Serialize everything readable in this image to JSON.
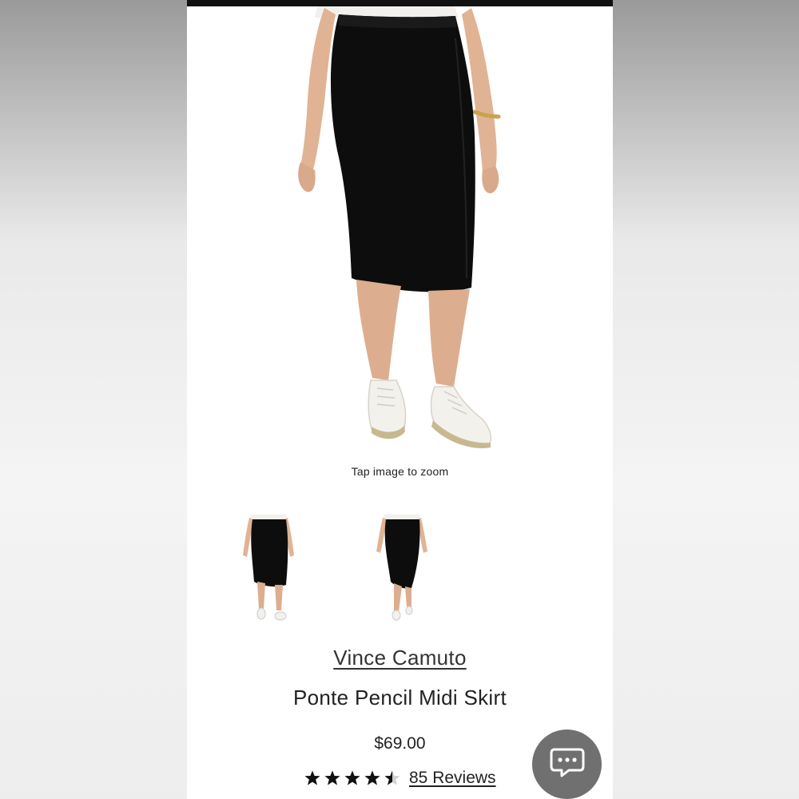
{
  "zoom_hint": "Tap image to zoom",
  "product": {
    "brand": "Vince Camuto",
    "name": "Ponte Pencil Midi Skirt",
    "price": "$69.00",
    "rating": 4.5,
    "rating_max": 5,
    "reviews_label": "85 Reviews"
  },
  "thumbnails": [
    "front-view",
    "back-view"
  ],
  "icons": {
    "chat": "chat-bubble-icon",
    "star": "star-icon"
  },
  "colors": {
    "skirt": "#0d0d0d",
    "chat_button": "#707070",
    "text": "#222222"
  }
}
